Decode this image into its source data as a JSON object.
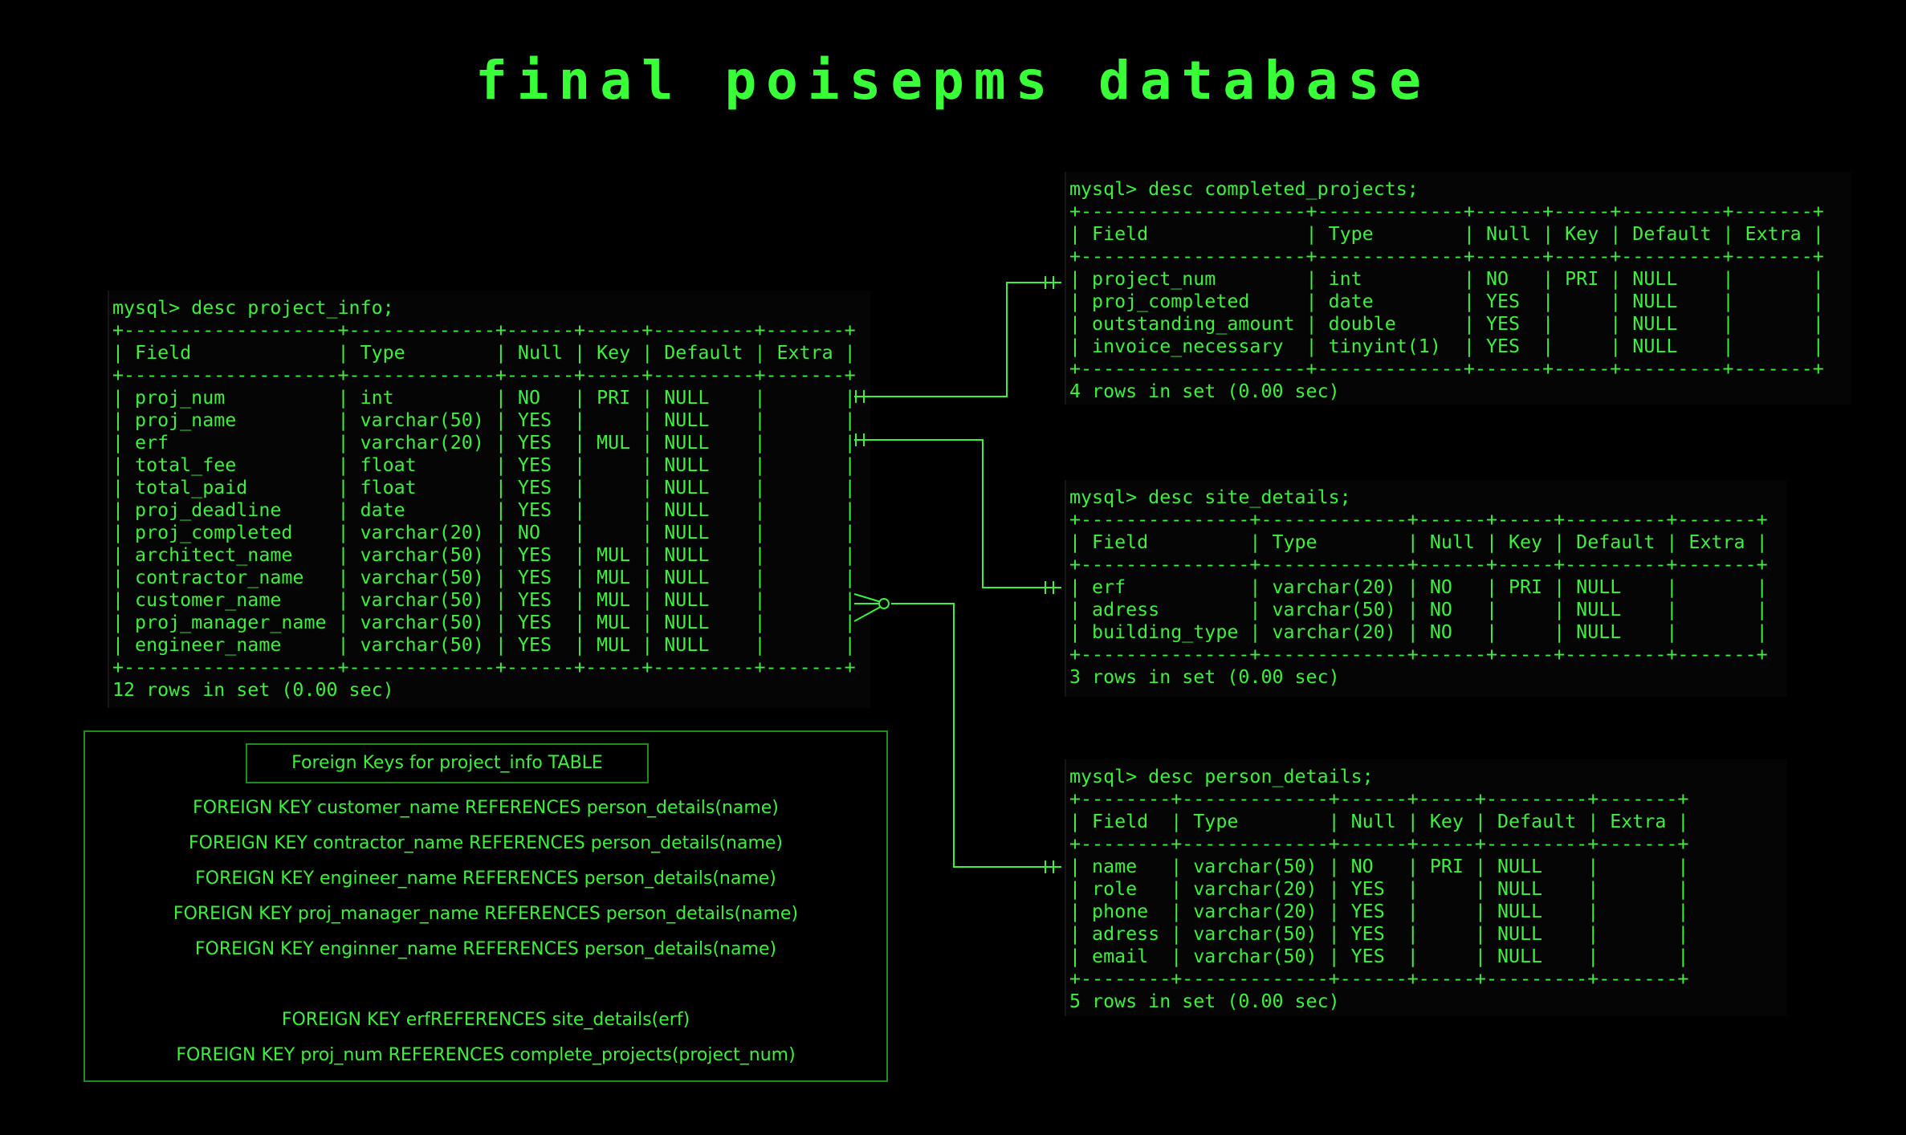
{
  "title": "final poisepms database",
  "project_info": {
    "lines": [
      "mysql> desc project_info;",
      "+-------------------+-------------+------+-----+---------+-------+",
      "| Field             | Type        | Null | Key | Default | Extra |",
      "+-------------------+-------------+------+-----+---------+-------+",
      "| proj_num          | int         | NO   | PRI | NULL    |       |",
      "| proj_name         | varchar(50) | YES  |     | NULL    |       |",
      "| erf               | varchar(20) | YES  | MUL | NULL    |       |",
      "| total_fee         | float       | YES  |     | NULL    |       |",
      "| total_paid        | float       | YES  |     | NULL    |       |",
      "| proj_deadline     | date        | YES  |     | NULL    |       |",
      "| proj_completed    | varchar(20) | NO   |     | NULL    |       |",
      "| architect_name    | varchar(50) | YES  | MUL | NULL    |       |",
      "| contractor_name   | varchar(50) | YES  | MUL | NULL    |       |",
      "| customer_name     | varchar(50) | YES  | MUL | NULL    |       |",
      "| proj_manager_name | varchar(50) | YES  | MUL | NULL    |       |",
      "| engineer_name     | varchar(50) | YES  | MUL | NULL    |       |",
      "+-------------------+-------------+------+-----+---------+-------+",
      "12 rows in set (0.00 sec)"
    ]
  },
  "completed_projects": {
    "lines": [
      "mysql> desc completed_projects;",
      "+--------------------+-------------+------+-----+---------+-------+",
      "| Field              | Type        | Null | Key | Default | Extra |",
      "+--------------------+-------------+------+-----+---------+-------+",
      "| project_num        | int         | NO   | PRI | NULL    |       |",
      "| proj_completed     | date        | YES  |     | NULL    |       |",
      "| outstanding_amount | double      | YES  |     | NULL    |       |",
      "| invoice_necessary  | tinyint(1)  | YES  |     | NULL    |       |",
      "+--------------------+-------------+------+-----+---------+-------+",
      "4 rows in set (0.00 sec)"
    ]
  },
  "site_details": {
    "lines": [
      "mysql> desc site_details;",
      "+---------------+-------------+------+-----+---------+-------+",
      "| Field         | Type        | Null | Key | Default | Extra |",
      "+---------------+-------------+------+-----+---------+-------+",
      "| erf           | varchar(20) | NO   | PRI | NULL    |       |",
      "| adress        | varchar(50) | NO   |     | NULL    |       |",
      "| building_type | varchar(20) | NO   |     | NULL    |       |",
      "+---------------+-------------+------+-----+---------+-------+",
      "3 rows in set (0.00 sec)"
    ]
  },
  "person_details": {
    "lines": [
      "mysql> desc person_details;",
      "+--------+-------------+------+-----+---------+-------+",
      "| Field  | Type        | Null | Key | Default | Extra |",
      "+--------+-------------+------+-----+---------+-------+",
      "| name   | varchar(50) | NO   | PRI | NULL    |       |",
      "| role   | varchar(20) | YES  |     | NULL    |       |",
      "| phone  | varchar(20) | YES  |     | NULL    |       |",
      "| adress | varchar(50) | YES  |     | NULL    |       |",
      "| email  | varchar(50) | YES  |     | NULL    |       |",
      "+--------+-------------+------+-----+---------+-------+",
      "5 rows in set (0.00 sec)"
    ]
  },
  "foreign_keys": {
    "header": "Foreign Keys for project_info TABLE",
    "lines": [
      "FOREIGN KEY customer_name REFERENCES person_details(name)",
      "FOREIGN KEY contractor_name REFERENCES person_details(name)",
      "FOREIGN KEY engineer_name REFERENCES person_details(name)",
      "FOREIGN KEY proj_manager_name REFERENCES person_details(name)",
      "FOREIGN KEY enginner_name REFERENCES person_details(name)",
      "FOREIGN KEY erfREFERENCES site_details(erf)",
      "FOREIGN KEY proj_num REFERENCES complete_projects(project_num)"
    ]
  },
  "colors": {
    "text": "#3ef03e",
    "title": "#39ff39",
    "border": "#1f8a1f",
    "background": "#000000"
  }
}
